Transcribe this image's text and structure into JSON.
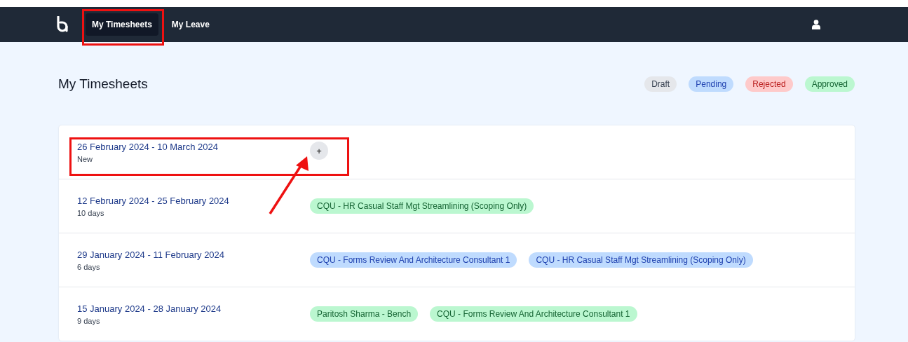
{
  "nav": {
    "tabs": [
      {
        "label": "My Timesheets",
        "selected": true
      },
      {
        "label": "My Leave",
        "selected": false
      }
    ]
  },
  "page": {
    "title": "My Timesheets"
  },
  "legend": [
    {
      "label": "Draft",
      "kind": "draft"
    },
    {
      "label": "Pending",
      "kind": "pending"
    },
    {
      "label": "Rejected",
      "kind": "rejected"
    },
    {
      "label": "Approved",
      "kind": "approved"
    }
  ],
  "timesheets": [
    {
      "dates": "26 February 2024 - 10 March 2024",
      "detail": "New",
      "add_button": "+"
    },
    {
      "dates": "12 February 2024 - 25 February 2024",
      "detail": "10 days",
      "tags": [
        {
          "label": "CQU - HR Casual Staff Mgt Streamlining (Scoping Only)",
          "kind": "approved"
        }
      ]
    },
    {
      "dates": "29 January 2024 - 11 February 2024",
      "detail": "6 days",
      "tags": [
        {
          "label": "CQU - Forms Review And Architecture Consultant 1",
          "kind": "pending"
        },
        {
          "label": "CQU - HR Casual Staff Mgt Streamlining (Scoping Only)",
          "kind": "pending"
        }
      ]
    },
    {
      "dates": "15 January 2024 - 28 January 2024",
      "detail": "9 days",
      "tags": [
        {
          "label": "Paritosh Sharma - Bench",
          "kind": "approved"
        },
        {
          "label": "CQU - Forms Review And Architecture Consultant 1",
          "kind": "approved"
        }
      ]
    }
  ]
}
